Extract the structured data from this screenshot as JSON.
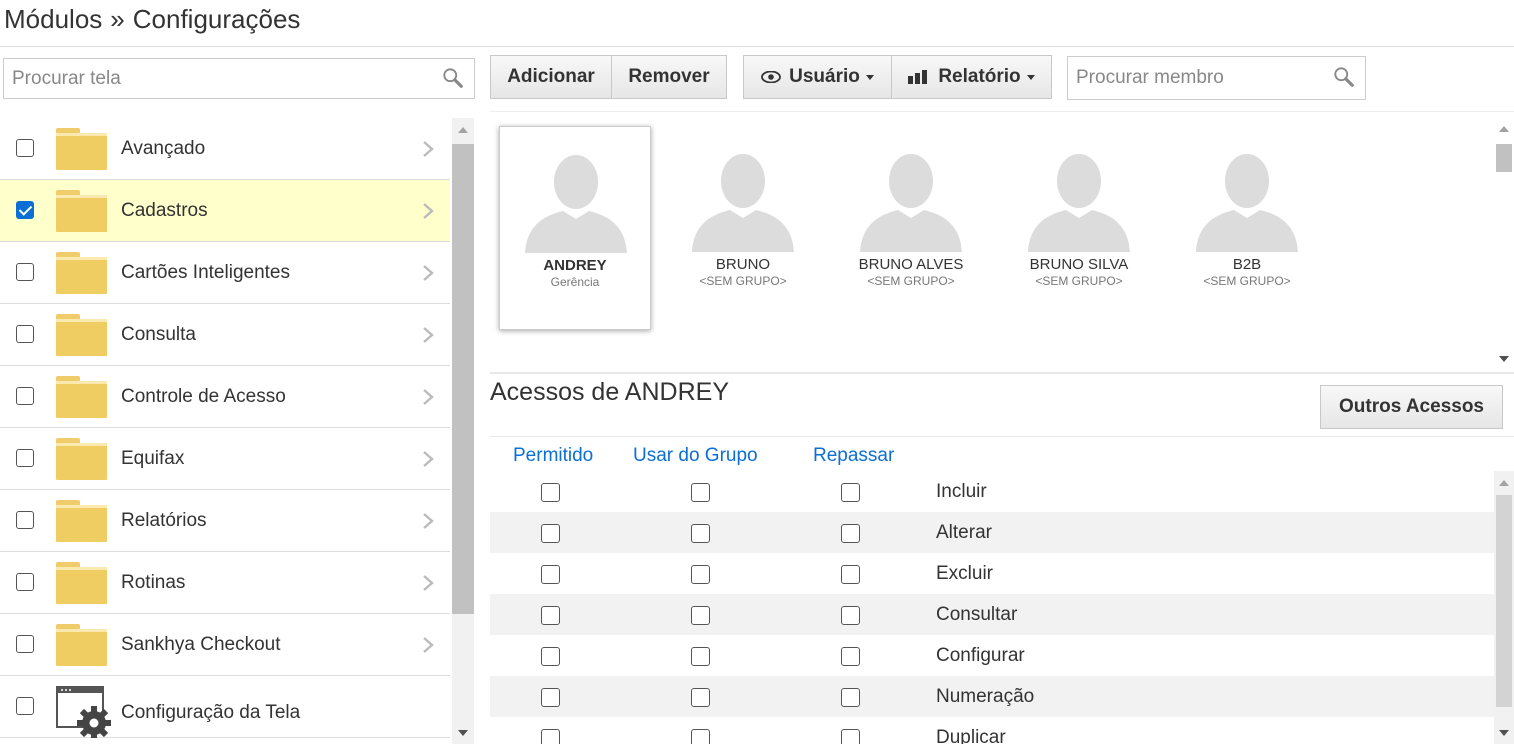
{
  "breadcrumb": {
    "root": "Módulos",
    "separator": "»",
    "current": "Configurações"
  },
  "left_panel": {
    "search_placeholder": "Procurar tela",
    "items": [
      {
        "label": "Avançado",
        "checked": false,
        "selected": false,
        "icon": "folder-icon"
      },
      {
        "label": "Cadastros",
        "checked": true,
        "selected": true,
        "icon": "folder-icon"
      },
      {
        "label": "Cartões Inteligentes",
        "checked": false,
        "selected": false,
        "icon": "folder-icon"
      },
      {
        "label": "Consulta",
        "checked": false,
        "selected": false,
        "icon": "folder-icon"
      },
      {
        "label": "Controle de Acesso",
        "checked": false,
        "selected": false,
        "icon": "folder-icon"
      },
      {
        "label": "Equifax",
        "checked": false,
        "selected": false,
        "icon": "folder-icon"
      },
      {
        "label": "Relatórios",
        "checked": false,
        "selected": false,
        "icon": "folder-icon"
      },
      {
        "label": "Rotinas",
        "checked": false,
        "selected": false,
        "icon": "folder-icon"
      },
      {
        "label": "Sankhya Checkout",
        "checked": false,
        "selected": false,
        "icon": "folder-icon"
      },
      {
        "label": "Configuração da Tela",
        "checked": false,
        "selected": false,
        "icon": "screen-settings-icon"
      }
    ]
  },
  "toolbar": {
    "add_label": "Adicionar",
    "remove_label": "Remover",
    "user_label": "Usuário",
    "report_label": "Relatório",
    "member_search_placeholder": "Procurar membro"
  },
  "members": [
    {
      "name": "ANDREY",
      "group": "Gerência",
      "selected": true
    },
    {
      "name": "BRUNO",
      "group": "<SEM GRUPO>",
      "selected": false
    },
    {
      "name": "BRUNO ALVES",
      "group": "<SEM GRUPO>",
      "selected": false
    },
    {
      "name": "BRUNO SILVA",
      "group": "<SEM GRUPO>",
      "selected": false
    },
    {
      "name": "B2B",
      "group": "<SEM GRUPO>",
      "selected": false
    }
  ],
  "access": {
    "title": "Acessos de ANDREY",
    "other_label": "Outros Acessos",
    "columns": [
      "Permitido",
      "Usar do Grupo",
      "Repassar"
    ],
    "rows": [
      {
        "label": "Incluir",
        "permitido": false,
        "usar_grupo": false,
        "repassar": false
      },
      {
        "label": "Alterar",
        "permitido": false,
        "usar_grupo": false,
        "repassar": false
      },
      {
        "label": "Excluir",
        "permitido": false,
        "usar_grupo": false,
        "repassar": false
      },
      {
        "label": "Consultar",
        "permitido": false,
        "usar_grupo": false,
        "repassar": false
      },
      {
        "label": "Configurar",
        "permitido": false,
        "usar_grupo": false,
        "repassar": false
      },
      {
        "label": "Numeração",
        "permitido": false,
        "usar_grupo": false,
        "repassar": false
      },
      {
        "label": "Duplicar",
        "permitido": false,
        "usar_grupo": false,
        "repassar": false
      }
    ]
  },
  "colors": {
    "accent": "#0b6fd6",
    "selected_row": "#ffffcc",
    "folder": "#f0cd63"
  }
}
